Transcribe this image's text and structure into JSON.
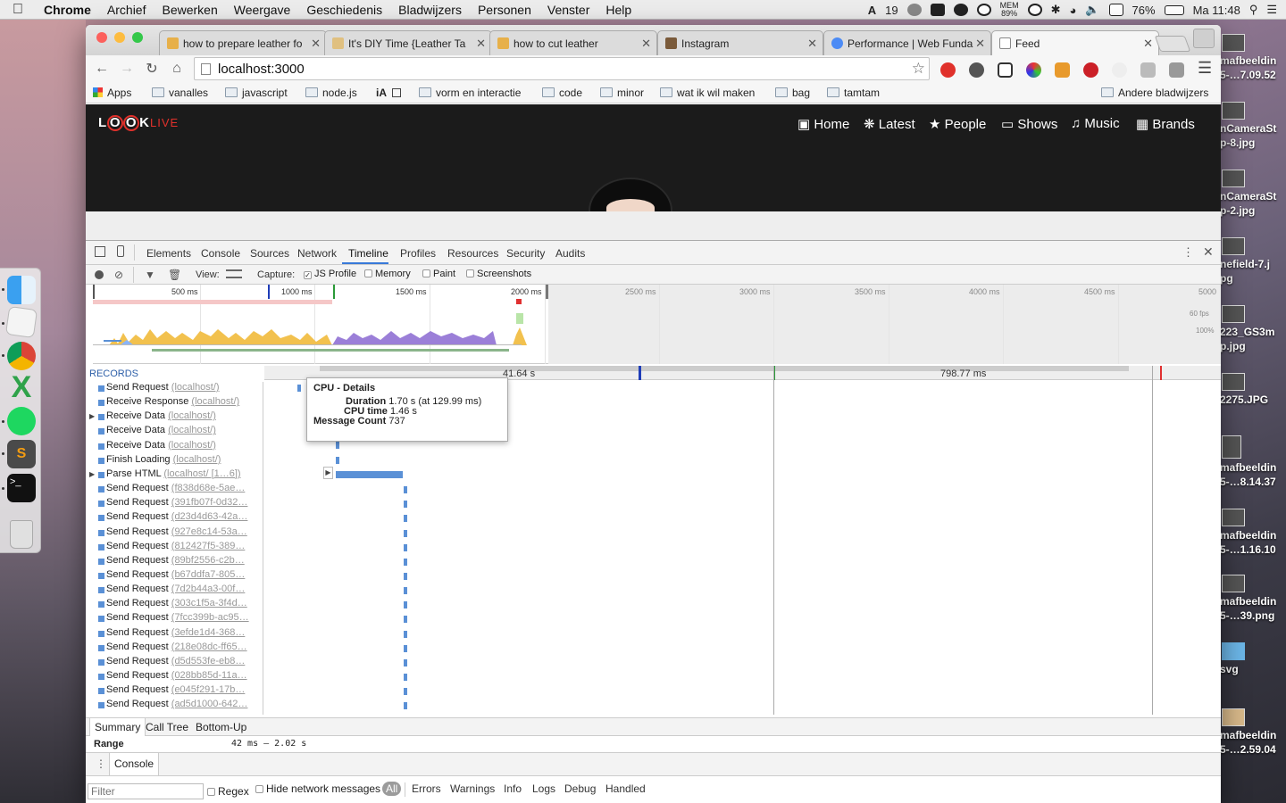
{
  "menubar": {
    "apple": "",
    "items": [
      "Chrome",
      "Archief",
      "Bewerken",
      "Weergave",
      "Geschiedenis",
      "Bladwijzers",
      "Personen",
      "Venster",
      "Help"
    ],
    "status_adobe": "19",
    "mem_label": "MEM",
    "mem_value": "89%",
    "battery": "76%",
    "clock": "Ma 11:48"
  },
  "browser": {
    "tabs": [
      {
        "title": "how to prepare leather fo"
      },
      {
        "title": "It's DIY Time {Leather Ta"
      },
      {
        "title": "how to cut leather"
      },
      {
        "title": "Instagram"
      },
      {
        "title": "Performance | Web Funda"
      },
      {
        "title": "Feed"
      }
    ],
    "url": "localhost:3000",
    "bookmarks": [
      "Apps",
      "vanalles",
      "javascript",
      "node.js",
      "iA",
      "vorm en interactie",
      "code",
      "minor",
      "wat ik wil maken",
      "bag",
      "tamtam"
    ],
    "other_bookmarks": "Andere bladwijzers"
  },
  "site": {
    "logo_main": "L",
    "logo_o1": "O",
    "logo_o2": "O",
    "logo_k": "K",
    "logo_live": "LIVE",
    "nav": [
      "Home",
      "Latest",
      "People",
      "Shows",
      "Music",
      "Brands"
    ]
  },
  "devtools": {
    "tabs": [
      "Elements",
      "Console",
      "Sources",
      "Network",
      "Timeline",
      "Profiles",
      "Resources",
      "Security",
      "Audits"
    ],
    "active_tab": "Timeline",
    "view_label": "View:",
    "capture_label": "Capture:",
    "capture_options": [
      {
        "label": "JS Profile",
        "checked": true
      },
      {
        "label": "Memory",
        "checked": false
      },
      {
        "label": "Paint",
        "checked": false
      },
      {
        "label": "Screenshots",
        "checked": false
      }
    ],
    "overview_ticks": [
      "500 ms",
      "1000 ms",
      "1500 ms",
      "2000 ms",
      "2500 ms",
      "3000 ms",
      "3500 ms",
      "4000 ms",
      "4500 ms",
      "5000"
    ],
    "fps_label": "60 fps",
    "cpu_label": "100%",
    "records_header": "RECORDS",
    "records": [
      {
        "name": "Send Request",
        "url": "(localhost/)"
      },
      {
        "name": "Receive Response",
        "url": "(localhost/)"
      },
      {
        "name": "Receive Data",
        "url": "(localhost/)",
        "expandable": true
      },
      {
        "name": "Receive Data",
        "url": "(localhost/)"
      },
      {
        "name": "Receive Data",
        "url": "(localhost/)"
      },
      {
        "name": "Finish Loading",
        "url": "(localhost/)"
      },
      {
        "name": "Parse HTML",
        "url": "(localhost/ [1…6])",
        "expandable": true
      },
      {
        "name": "Send Request",
        "url": "(f838d68e-5ae…"
      },
      {
        "name": "Send Request",
        "url": "(391fb07f-0d32…"
      },
      {
        "name": "Send Request",
        "url": "(d23d4d63-42a…"
      },
      {
        "name": "Send Request",
        "url": "(927e8c14-53a…"
      },
      {
        "name": "Send Request",
        "url": "(812427f5-389…"
      },
      {
        "name": "Send Request",
        "url": "(89bf2556-c2b…"
      },
      {
        "name": "Send Request",
        "url": "(b67ddfa7-805…"
      },
      {
        "name": "Send Request",
        "url": "(7d2b44a3-00f…"
      },
      {
        "name": "Send Request",
        "url": "(303c1f5a-3f4d…"
      },
      {
        "name": "Send Request",
        "url": "(7fcc399b-ac95…"
      },
      {
        "name": "Send Request",
        "url": "(3efde1d4-368…"
      },
      {
        "name": "Send Request",
        "url": "(218e08dc-ff65…"
      },
      {
        "name": "Send Request",
        "url": "(d5d553fe-eb8…"
      },
      {
        "name": "Send Request",
        "url": "(028bb85d-11a…"
      },
      {
        "name": "Send Request",
        "url": "(e045f291-17b…"
      },
      {
        "name": "Send Request",
        "url": "(ad5d1000-642…"
      }
    ],
    "flame_axis_left": "41.64 s",
    "flame_axis_right": "798.77 ms",
    "tooltip": {
      "title": "CPU - Details",
      "duration_label": "Duration",
      "duration_value": "1.70 s (at 129.99 ms)",
      "cpu_label": "CPU time",
      "cpu_value": "1.46 s",
      "msg_label": "Message Count",
      "msg_value": "737"
    },
    "summary_tabs": [
      "Summary",
      "Call Tree",
      "Bottom-Up"
    ],
    "range_label": "Range",
    "range_value": "42 ms – 2.02 s",
    "drawer_tab": "Console",
    "filter_placeholder": "Filter",
    "regex_label": "Regex",
    "hide_network_label": "Hide network messages",
    "levels": [
      "All",
      "Errors",
      "Warnings",
      "Info",
      "Logs",
      "Debug",
      "Handled"
    ]
  },
  "desktop": {
    "items": [
      "mafbeeldin\n5-…7.09.52",
      "nCameraSt\np-8.jpg",
      "nCameraSt\np-2.jpg",
      "nefield-7.j\npg",
      "223_GS3m\np.jpg",
      "2275.JPG",
      "mafbeeldin\n5-…8.14.37",
      "mafbeeldin\n5-…1.16.10",
      "mafbeeldin\n5-…39.png",
      "svg",
      "mafbeeldin\n5-…2.59.04"
    ]
  }
}
